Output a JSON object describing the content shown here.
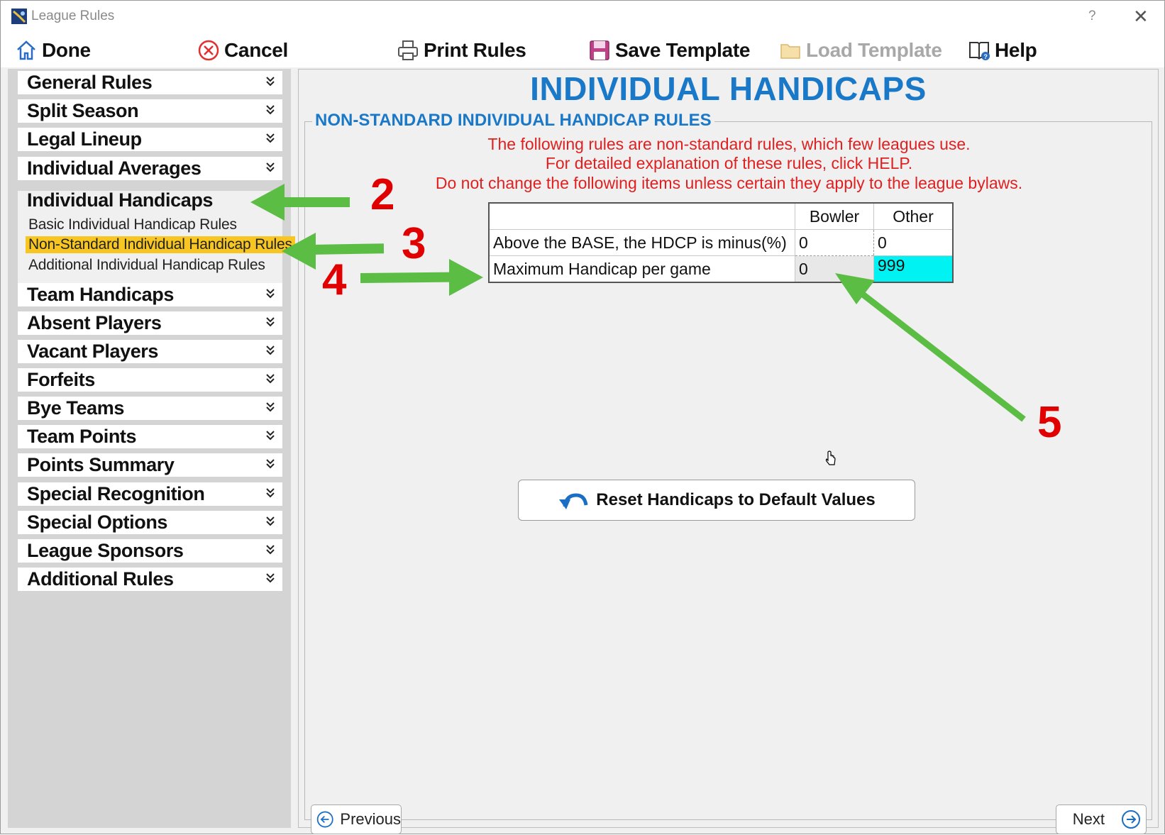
{
  "window": {
    "title": "League Rules",
    "help_glyph": "?",
    "close_glyph": "✕"
  },
  "toolbar": {
    "done": "Done",
    "cancel": "Cancel",
    "print": "Print Rules",
    "save_template": "Save Template",
    "load_template": "Load Template",
    "help": "Help"
  },
  "sidebar": {
    "items": [
      "General Rules",
      "Split Season",
      "Legal Lineup",
      "Individual Averages",
      "Individual Handicaps",
      "Team Handicaps",
      "Absent Players",
      "Vacant Players",
      "Forfeits",
      "Bye Teams",
      "Team Points",
      "Points Summary",
      "Special Recognition",
      "Special Options",
      "League Sponsors",
      "Additional Rules"
    ],
    "sub_items": [
      "Basic Individual Handicap Rules",
      "Non-Standard Individual Handicap Rules",
      "Additional Individual Handicap Rules"
    ],
    "active_sub": 1
  },
  "main": {
    "title": "INDIVIDUAL HANDICAPS",
    "group_title": "NON-STANDARD INDIVIDUAL HANDICAP RULES",
    "warning_lines": [
      "The following rules are non-standard rules, which few leagues use.",
      "For detailed explanation of these rules, click HELP.",
      "Do not change the following items unless certain they apply to the league bylaws."
    ],
    "table": {
      "headers": [
        "",
        "Bowler",
        "Other"
      ],
      "rows": [
        {
          "label": "Above the BASE, the HDCP is minus(%)",
          "bowler": "0",
          "other": "0"
        },
        {
          "label": "Maximum Handicap per game",
          "bowler": "0",
          "other": "999"
        }
      ]
    },
    "reset_button": "Reset Handicaps to Default Values",
    "previous": "Previous",
    "next": "Next"
  },
  "annotations": [
    "2",
    "3",
    "4",
    "5"
  ],
  "colors": {
    "accent_blue": "#1a78c8",
    "warning_red": "#e02020",
    "highlight_yellow": "#f7c623",
    "cell_cyan": "#00f2f2",
    "arrow_green": "#5cbd45",
    "annotation_red": "#e00000"
  }
}
